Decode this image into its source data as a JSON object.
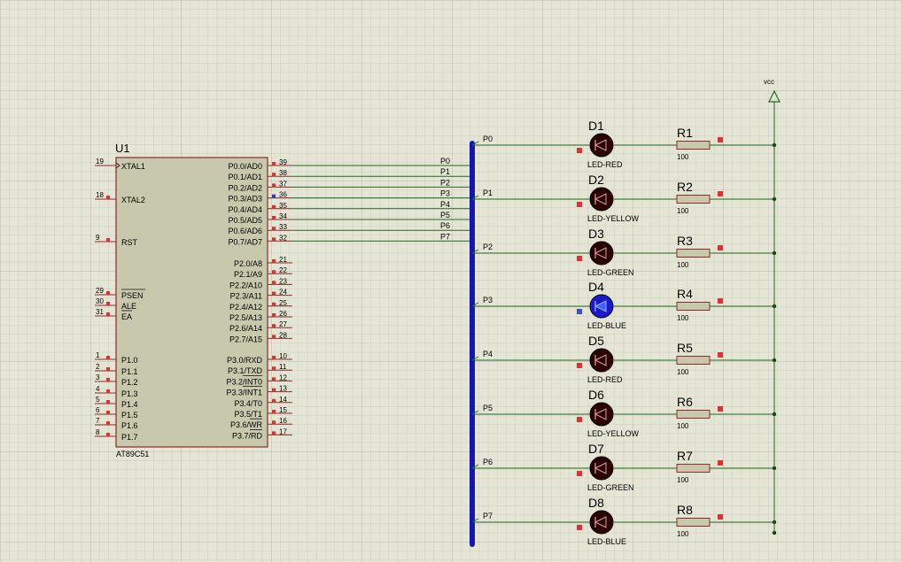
{
  "colors": {
    "background": "#e5e5d5",
    "chip_fill": "#c8c8ac",
    "chip_border": "#8b2a2a",
    "wire": "#1f6b1f",
    "bus": "#1515b0",
    "pin_marker": "#e03030",
    "led_body": "#2b0000",
    "led_blue_body": "#1a1acd",
    "resistor_fill": "#c8c8ac",
    "text": "#101010"
  },
  "chip": {
    "ref": "U1",
    "part": "AT89C51",
    "left_pins": [
      {
        "num": "19",
        "label": "XTAL1"
      },
      {
        "num": "18",
        "label": "XTAL2"
      },
      {
        "num": "9",
        "label": "RST"
      },
      {
        "num": "29",
        "label": "PSEN"
      },
      {
        "num": "30",
        "label": "ALE"
      },
      {
        "num": "31",
        "label": "EA"
      },
      {
        "num": "1",
        "label": "P1.0"
      },
      {
        "num": "2",
        "label": "P1.1"
      },
      {
        "num": "3",
        "label": "P1.2"
      },
      {
        "num": "4",
        "label": "P1.3"
      },
      {
        "num": "5",
        "label": "P1.4"
      },
      {
        "num": "6",
        "label": "P1.5"
      },
      {
        "num": "7",
        "label": "P1.6"
      },
      {
        "num": "8",
        "label": "P1.7"
      }
    ],
    "right_pins": [
      {
        "num": "39",
        "label": "P0.0/AD0"
      },
      {
        "num": "38",
        "label": "P0.1/AD1"
      },
      {
        "num": "37",
        "label": "P0.2/AD2"
      },
      {
        "num": "36",
        "label": "P0.3/AD3"
      },
      {
        "num": "35",
        "label": "P0.4/AD4"
      },
      {
        "num": "34",
        "label": "P0.5/AD5"
      },
      {
        "num": "33",
        "label": "P0.6/AD6"
      },
      {
        "num": "32",
        "label": "P0.7/AD7"
      },
      {
        "num": "21",
        "label": "P2.0/A8"
      },
      {
        "num": "22",
        "label": "P2.1/A9"
      },
      {
        "num": "23",
        "label": "P2.2/A10"
      },
      {
        "num": "24",
        "label": "P2.3/A11"
      },
      {
        "num": "25",
        "label": "P2.4/A12"
      },
      {
        "num": "26",
        "label": "P2.5/A13"
      },
      {
        "num": "27",
        "label": "P2.6/A14"
      },
      {
        "num": "28",
        "label": "P2.7/A15"
      },
      {
        "num": "10",
        "label": "P3.0/RXD"
      },
      {
        "num": "11",
        "label": "P3.1/TXD"
      },
      {
        "num": "12",
        "label": "P3.2/INT0"
      },
      {
        "num": "13",
        "label": "P3.3/INT1"
      },
      {
        "num": "14",
        "label": "P3.4/T0"
      },
      {
        "num": "15",
        "label": "P3.5/T1"
      },
      {
        "num": "16",
        "label": "P3.6/WR"
      },
      {
        "num": "17",
        "label": "P3.7/RD"
      }
    ]
  },
  "bus_nets": [
    "P0",
    "P1",
    "P2",
    "P3",
    "P4",
    "P5",
    "P6",
    "P7"
  ],
  "power_label": "vcc",
  "leds": [
    {
      "ref": "D1",
      "type": "LED-RED",
      "lit": false
    },
    {
      "ref": "D2",
      "type": "LED-YELLOW",
      "lit": false
    },
    {
      "ref": "D3",
      "type": "LED-GREEN",
      "lit": false
    },
    {
      "ref": "D4",
      "type": "LED-BLUE",
      "lit": true
    },
    {
      "ref": "D5",
      "type": "LED-RED",
      "lit": false
    },
    {
      "ref": "D6",
      "type": "LED-YELLOW",
      "lit": false
    },
    {
      "ref": "D7",
      "type": "LED-GREEN",
      "lit": false
    },
    {
      "ref": "D8",
      "type": "LED-BLUE",
      "lit": false
    }
  ],
  "resistors": [
    {
      "ref": "R1",
      "value": "100"
    },
    {
      "ref": "R2",
      "value": "100"
    },
    {
      "ref": "R3",
      "value": "100"
    },
    {
      "ref": "R4",
      "value": "100"
    },
    {
      "ref": "R5",
      "value": "100"
    },
    {
      "ref": "R6",
      "value": "100"
    },
    {
      "ref": "R7",
      "value": "100"
    },
    {
      "ref": "R8",
      "value": "100"
    }
  ]
}
